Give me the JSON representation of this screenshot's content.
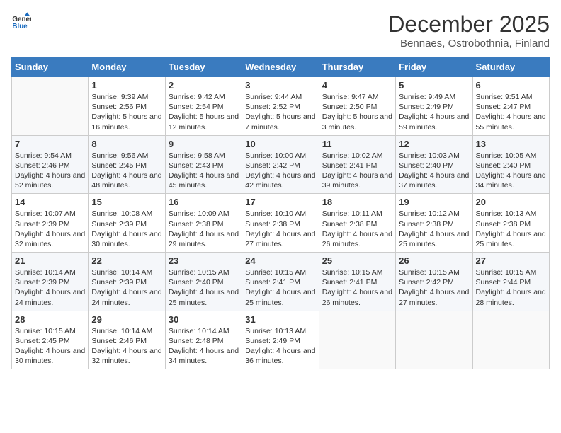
{
  "logo": {
    "general": "General",
    "blue": "Blue"
  },
  "title": "December 2025",
  "subtitle": "Bennaes, Ostrobothnia, Finland",
  "days_of_week": [
    "Sunday",
    "Monday",
    "Tuesday",
    "Wednesday",
    "Thursday",
    "Friday",
    "Saturday"
  ],
  "weeks": [
    [
      {
        "day": "",
        "info": ""
      },
      {
        "day": "1",
        "info": "Sunrise: 9:39 AM\nSunset: 2:56 PM\nDaylight: 5 hours\nand 16 minutes."
      },
      {
        "day": "2",
        "info": "Sunrise: 9:42 AM\nSunset: 2:54 PM\nDaylight: 5 hours\nand 12 minutes."
      },
      {
        "day": "3",
        "info": "Sunrise: 9:44 AM\nSunset: 2:52 PM\nDaylight: 5 hours\nand 7 minutes."
      },
      {
        "day": "4",
        "info": "Sunrise: 9:47 AM\nSunset: 2:50 PM\nDaylight: 5 hours\nand 3 minutes."
      },
      {
        "day": "5",
        "info": "Sunrise: 9:49 AM\nSunset: 2:49 PM\nDaylight: 4 hours\nand 59 minutes."
      },
      {
        "day": "6",
        "info": "Sunrise: 9:51 AM\nSunset: 2:47 PM\nDaylight: 4 hours\nand 55 minutes."
      }
    ],
    [
      {
        "day": "7",
        "info": "Sunrise: 9:54 AM\nSunset: 2:46 PM\nDaylight: 4 hours\nand 52 minutes."
      },
      {
        "day": "8",
        "info": "Sunrise: 9:56 AM\nSunset: 2:45 PM\nDaylight: 4 hours\nand 48 minutes."
      },
      {
        "day": "9",
        "info": "Sunrise: 9:58 AM\nSunset: 2:43 PM\nDaylight: 4 hours\nand 45 minutes."
      },
      {
        "day": "10",
        "info": "Sunrise: 10:00 AM\nSunset: 2:42 PM\nDaylight: 4 hours\nand 42 minutes."
      },
      {
        "day": "11",
        "info": "Sunrise: 10:02 AM\nSunset: 2:41 PM\nDaylight: 4 hours\nand 39 minutes."
      },
      {
        "day": "12",
        "info": "Sunrise: 10:03 AM\nSunset: 2:40 PM\nDaylight: 4 hours\nand 37 minutes."
      },
      {
        "day": "13",
        "info": "Sunrise: 10:05 AM\nSunset: 2:40 PM\nDaylight: 4 hours\nand 34 minutes."
      }
    ],
    [
      {
        "day": "14",
        "info": "Sunrise: 10:07 AM\nSunset: 2:39 PM\nDaylight: 4 hours\nand 32 minutes."
      },
      {
        "day": "15",
        "info": "Sunrise: 10:08 AM\nSunset: 2:39 PM\nDaylight: 4 hours\nand 30 minutes."
      },
      {
        "day": "16",
        "info": "Sunrise: 10:09 AM\nSunset: 2:38 PM\nDaylight: 4 hours\nand 29 minutes."
      },
      {
        "day": "17",
        "info": "Sunrise: 10:10 AM\nSunset: 2:38 PM\nDaylight: 4 hours\nand 27 minutes."
      },
      {
        "day": "18",
        "info": "Sunrise: 10:11 AM\nSunset: 2:38 PM\nDaylight: 4 hours\nand 26 minutes."
      },
      {
        "day": "19",
        "info": "Sunrise: 10:12 AM\nSunset: 2:38 PM\nDaylight: 4 hours\nand 25 minutes."
      },
      {
        "day": "20",
        "info": "Sunrise: 10:13 AM\nSunset: 2:38 PM\nDaylight: 4 hours\nand 25 minutes."
      }
    ],
    [
      {
        "day": "21",
        "info": "Sunrise: 10:14 AM\nSunset: 2:39 PM\nDaylight: 4 hours\nand 24 minutes."
      },
      {
        "day": "22",
        "info": "Sunrise: 10:14 AM\nSunset: 2:39 PM\nDaylight: 4 hours\nand 24 minutes."
      },
      {
        "day": "23",
        "info": "Sunrise: 10:15 AM\nSunset: 2:40 PM\nDaylight: 4 hours\nand 25 minutes."
      },
      {
        "day": "24",
        "info": "Sunrise: 10:15 AM\nSunset: 2:41 PM\nDaylight: 4 hours\nand 25 minutes."
      },
      {
        "day": "25",
        "info": "Sunrise: 10:15 AM\nSunset: 2:41 PM\nDaylight: 4 hours\nand 26 minutes."
      },
      {
        "day": "26",
        "info": "Sunrise: 10:15 AM\nSunset: 2:42 PM\nDaylight: 4 hours\nand 27 minutes."
      },
      {
        "day": "27",
        "info": "Sunrise: 10:15 AM\nSunset: 2:44 PM\nDaylight: 4 hours\nand 28 minutes."
      }
    ],
    [
      {
        "day": "28",
        "info": "Sunrise: 10:15 AM\nSunset: 2:45 PM\nDaylight: 4 hours\nand 30 minutes."
      },
      {
        "day": "29",
        "info": "Sunrise: 10:14 AM\nSunset: 2:46 PM\nDaylight: 4 hours\nand 32 minutes."
      },
      {
        "day": "30",
        "info": "Sunrise: 10:14 AM\nSunset: 2:48 PM\nDaylight: 4 hours\nand 34 minutes."
      },
      {
        "day": "31",
        "info": "Sunrise: 10:13 AM\nSunset: 2:49 PM\nDaylight: 4 hours\nand 36 minutes."
      },
      {
        "day": "",
        "info": ""
      },
      {
        "day": "",
        "info": ""
      },
      {
        "day": "",
        "info": ""
      }
    ]
  ]
}
